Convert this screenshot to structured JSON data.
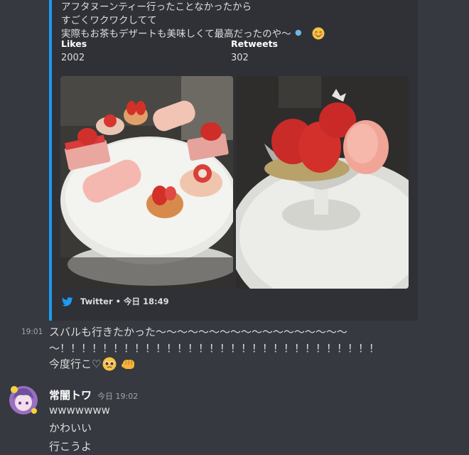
{
  "embed": {
    "description": "アフタヌーンティー行ったことなかったから\nすごくワクワクしてて\n実際もお茶もデザートも美味しくて最高だったのや〜",
    "fields": [
      {
        "name": "Likes",
        "value": "2002"
      },
      {
        "name": "Retweets",
        "value": "302"
      }
    ],
    "footer": {
      "source": "Twitter",
      "separator": "•",
      "time": "今日 18:49"
    },
    "accent_color": "#1d9bf0"
  },
  "message1": {
    "timestamp": "19:01",
    "line1": "スバルも行きたかった〜〜〜〜〜〜〜〜〜〜〜〜〜〜〜〜〜〜",
    "line2": "〜！！！！！！！！！！！！！！！！！！！！！！！！！！！！！！",
    "line3": "今度行こ♡"
  },
  "message2": {
    "author": "常闇トワ",
    "timestamp": "今日 19:02",
    "lines": [
      "wwwwwww",
      "かわいい",
      "行こうよ"
    ]
  }
}
